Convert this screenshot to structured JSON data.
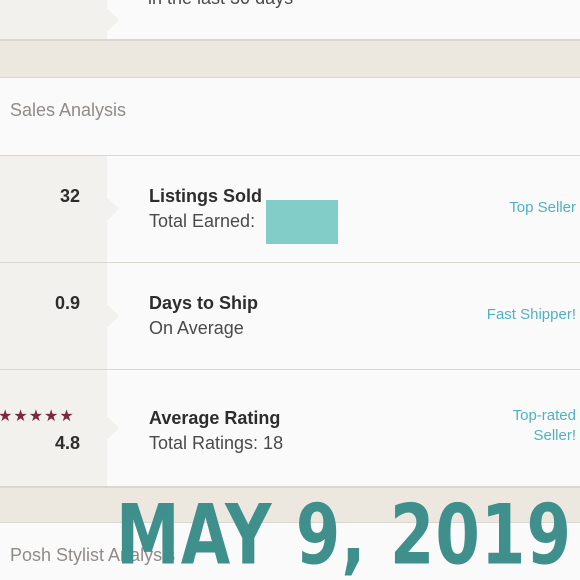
{
  "top": {
    "partial_text": "in the last 30 days"
  },
  "sales_analysis": {
    "header": "Sales Analysis",
    "rows": [
      {
        "metric": "32",
        "title": "Listings Sold",
        "subtitle": "Total Earned:",
        "badge": "Top Seller"
      },
      {
        "metric": "0.9",
        "title": "Days to Ship",
        "subtitle": "On Average",
        "badge": "Fast Shipper!"
      },
      {
        "metric": "4.8",
        "stars": "★★★★★",
        "title": "Average Rating",
        "subtitle": "Total Ratings: 18",
        "badge_line1": "Top-rated",
        "badge_line2": "Seller!"
      }
    ]
  },
  "posh_stylist": {
    "header": "Posh Stylist Analysis"
  },
  "overlay": {
    "date_text": "MAY 9, 2019"
  },
  "colors": {
    "accent": "#4fb1c4",
    "star": "#7a2a3c",
    "overlay_text": "#3f8f8d",
    "redaction": "#82cdc8"
  }
}
